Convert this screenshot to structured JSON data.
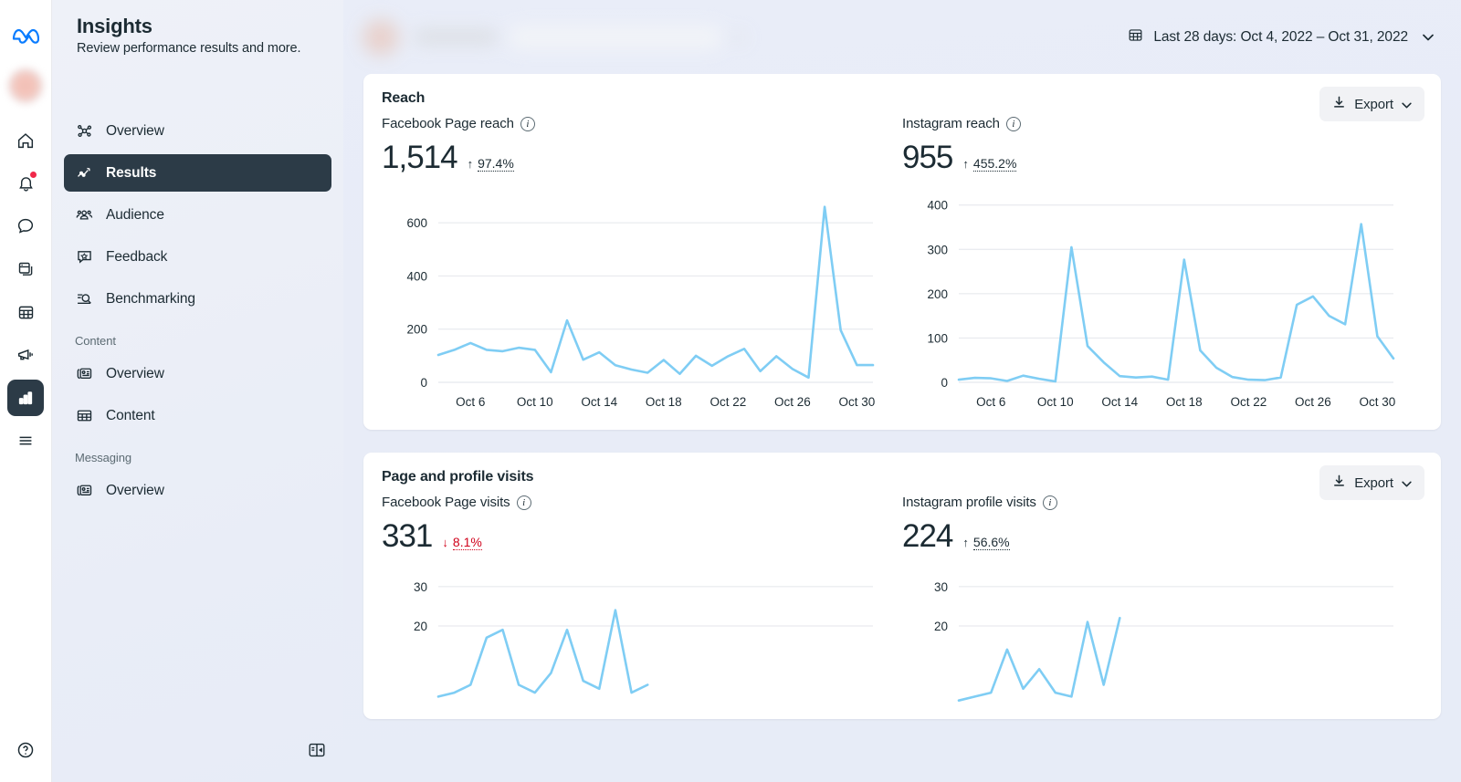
{
  "rail": {
    "logo_icon": "meta-logo-icon",
    "avatar_icon": "user-avatar",
    "items": [
      {
        "icon": "home-icon",
        "name": "home",
        "active": false,
        "badge": false
      },
      {
        "icon": "bell-icon",
        "name": "notifications",
        "active": false,
        "badge": true
      },
      {
        "icon": "chat-bubble-icon",
        "name": "inbox",
        "active": false,
        "badge": false
      },
      {
        "icon": "posts-icon",
        "name": "posts",
        "active": false,
        "badge": false
      },
      {
        "icon": "planner-grid-icon",
        "name": "planner",
        "active": false,
        "badge": false
      },
      {
        "icon": "megaphone-icon",
        "name": "ads",
        "active": false,
        "badge": false
      },
      {
        "icon": "bar-chart-icon",
        "name": "insights",
        "active": true,
        "badge": false
      },
      {
        "icon": "hamburger-menu-icon",
        "name": "all-tools",
        "active": false,
        "badge": false
      }
    ],
    "help_icon": "question-mark-icon"
  },
  "sidebar": {
    "title": "Insights",
    "subtitle": "Review performance results and more.",
    "collapse_icon": "collapse-panel-icon",
    "items": [
      {
        "label": "Overview",
        "icon": "network-nodes-icon",
        "active": false,
        "type": "item"
      },
      {
        "label": "Results",
        "icon": "trend-line-icon",
        "active": true,
        "type": "item"
      },
      {
        "label": "Audience",
        "icon": "people-group-icon",
        "active": false,
        "type": "item"
      },
      {
        "label": "Feedback",
        "icon": "star-bubble-icon",
        "active": false,
        "type": "item"
      },
      {
        "label": "Benchmarking",
        "icon": "list-search-icon",
        "active": false,
        "type": "item"
      },
      {
        "label": "Content",
        "type": "section"
      },
      {
        "label": "Overview",
        "icon": "card-stack-icon",
        "active": false,
        "type": "item"
      },
      {
        "label": "Content",
        "icon": "table-grid-icon",
        "active": false,
        "type": "item"
      },
      {
        "label": "Messaging",
        "type": "section"
      },
      {
        "label": "Overview",
        "icon": "card-stack-icon",
        "active": false,
        "type": "item"
      }
    ]
  },
  "topbar": {
    "page_selector_redacted": true,
    "date_range": "Last 28 days: Oct 4, 2022 – Oct 31, 2022",
    "calendar_icon": "calendar-icon",
    "caret_icon": "chevron-down-icon"
  },
  "cards": [
    {
      "title": "Reach",
      "export_label": "Export",
      "export_icon": "download-icon",
      "export_caret_icon": "chevron-down-icon",
      "metrics": [
        {
          "label": "Facebook Page reach",
          "info_icon": "info-icon",
          "value": "1,514",
          "delta": "97.4%",
          "direction": "up",
          "arrow": "↑"
        },
        {
          "label": "Instagram reach",
          "info_icon": "info-icon",
          "value": "955",
          "delta": "455.2%",
          "direction": "up",
          "arrow": "↑"
        }
      ]
    },
    {
      "title": "Page and profile visits",
      "export_label": "Export",
      "export_icon": "download-icon",
      "export_caret_icon": "chevron-down-icon",
      "metrics": [
        {
          "label": "Facebook Page visits",
          "info_icon": "info-icon",
          "value": "331",
          "delta": "8.1%",
          "direction": "down",
          "arrow": "↓"
        },
        {
          "label": "Instagram profile visits",
          "info_icon": "info-icon",
          "value": "224",
          "delta": "56.6%",
          "direction": "up",
          "arrow": "↑"
        }
      ]
    }
  ],
  "chart_data": [
    {
      "type": "line",
      "title": "Facebook Page reach",
      "xlabel": "",
      "ylabel": "",
      "grid": true,
      "legend": null,
      "line_color": "#7FCDF4",
      "ylim": [
        0,
        700
      ],
      "yticks": [
        0,
        200,
        400,
        600
      ],
      "xticks": [
        "Oct 6",
        "Oct 10",
        "Oct 14",
        "Oct 18",
        "Oct 22",
        "Oct 26",
        "Oct 30"
      ],
      "x": [
        "Oct 4",
        "Oct 5",
        "Oct 6",
        "Oct 7",
        "Oct 8",
        "Oct 9",
        "Oct 10",
        "Oct 11",
        "Oct 12",
        "Oct 13",
        "Oct 14",
        "Oct 15",
        "Oct 16",
        "Oct 17",
        "Oct 18",
        "Oct 19",
        "Oct 20",
        "Oct 21",
        "Oct 22",
        "Oct 23",
        "Oct 24",
        "Oct 25",
        "Oct 26",
        "Oct 27",
        "Oct 28",
        "Oct 29",
        "Oct 30",
        "Oct 31"
      ],
      "values": [
        103,
        122,
        148,
        122,
        117,
        130,
        122,
        38,
        233,
        85,
        113,
        64,
        48,
        36,
        84,
        32,
        100,
        62,
        98,
        126,
        42,
        98,
        50,
        18,
        660,
        196,
        65,
        65
      ]
    },
    {
      "type": "line",
      "title": "Instagram reach",
      "xlabel": "",
      "ylabel": "",
      "grid": true,
      "legend": null,
      "line_color": "#7FCDF4",
      "ylim": [
        0,
        420
      ],
      "yticks": [
        0,
        100,
        200,
        300,
        400
      ],
      "xticks": [
        "Oct 6",
        "Oct 10",
        "Oct 14",
        "Oct 18",
        "Oct 22",
        "Oct 26",
        "Oct 30"
      ],
      "x": [
        "Oct 4",
        "Oct 5",
        "Oct 6",
        "Oct 7",
        "Oct 8",
        "Oct 9",
        "Oct 10",
        "Oct 11",
        "Oct 12",
        "Oct 13",
        "Oct 14",
        "Oct 15",
        "Oct 16",
        "Oct 17",
        "Oct 18",
        "Oct 19",
        "Oct 20",
        "Oct 21",
        "Oct 22",
        "Oct 23",
        "Oct 24",
        "Oct 25",
        "Oct 26",
        "Oct 27",
        "Oct 28",
        "Oct 29",
        "Oct 30",
        "Oct 31"
      ],
      "values": [
        6,
        10,
        9,
        3,
        15,
        8,
        2,
        305,
        82,
        45,
        14,
        11,
        13,
        6,
        277,
        72,
        33,
        12,
        6,
        5,
        11,
        175,
        194,
        150,
        131,
        357,
        104,
        54
      ]
    },
    {
      "type": "line",
      "title": "Facebook Page visits",
      "xlabel": "",
      "ylabel": "",
      "grid": true,
      "legend": null,
      "line_color": "#7FCDF4",
      "ylim": [
        0,
        33
      ],
      "yticks": [
        20,
        30
      ],
      "xticks": [],
      "x": [
        "Oct 4",
        "Oct 5",
        "Oct 6",
        "Oct 7",
        "Oct 8",
        "Oct 9",
        "Oct 10",
        "Oct 11",
        "Oct 12",
        "Oct 13",
        "Oct 14",
        "Oct 15",
        "Oct 16",
        "Oct 17"
      ],
      "values": [
        2,
        3,
        5,
        17,
        19,
        5,
        3,
        8,
        19,
        6,
        4,
        24,
        3,
        5
      ]
    },
    {
      "type": "line",
      "title": "Instagram profile visits",
      "xlabel": "",
      "ylabel": "",
      "grid": true,
      "legend": null,
      "line_color": "#7FCDF4",
      "ylim": [
        0,
        33
      ],
      "yticks": [
        20,
        30
      ],
      "xticks": [],
      "x": [
        "Oct 4",
        "Oct 5",
        "Oct 6",
        "Oct 7",
        "Oct 8",
        "Oct 9",
        "Oct 10",
        "Oct 11",
        "Oct 12",
        "Oct 13",
        "Oct 14"
      ],
      "values": [
        1,
        2,
        3,
        14,
        4,
        9,
        3,
        2,
        21,
        5,
        22
      ]
    }
  ]
}
